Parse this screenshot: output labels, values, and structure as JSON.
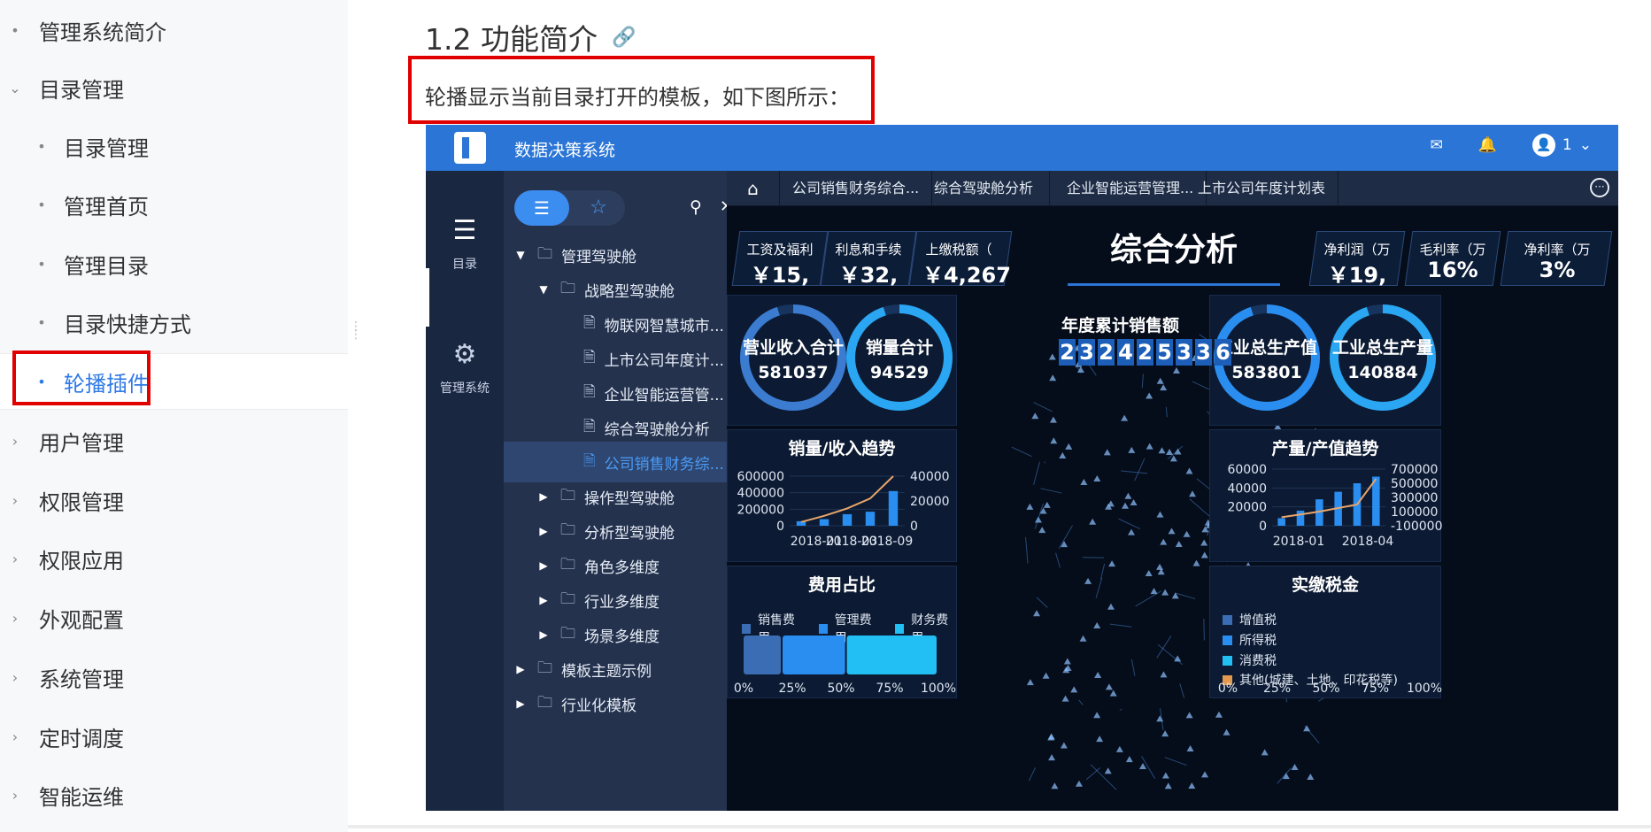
{
  "sidebar": {
    "items": [
      {
        "label": "管理系统简介",
        "mark": "•"
      },
      {
        "label": "目录管理",
        "mark": "⌄"
      },
      {
        "label": "目录管理",
        "mark": "•"
      },
      {
        "label": "管理首页",
        "mark": "•"
      },
      {
        "label": "管理目录",
        "mark": "•"
      },
      {
        "label": "目录快捷方式",
        "mark": "•"
      },
      {
        "label": "轮播插件",
        "mark": "•"
      },
      {
        "label": "用户管理",
        "mark": "›"
      },
      {
        "label": "权限管理",
        "mark": "›"
      },
      {
        "label": "权限应用",
        "mark": "›"
      },
      {
        "label": "外观配置",
        "mark": "›"
      },
      {
        "label": "系统管理",
        "mark": "›"
      },
      {
        "label": "定时调度",
        "mark": "›"
      },
      {
        "label": "智能运维",
        "mark": "›"
      }
    ]
  },
  "content": {
    "heading": "1.2 功能简介",
    "description": "轮播显示当前目录打开的模板，如下图所示："
  },
  "screenshot": {
    "app_title": "数据决策系统",
    "user_label": "1",
    "rail": {
      "catalog": "目录",
      "manage": "管理系统"
    },
    "tabs": [
      "公司销售财务综合...",
      "综合驾驶舱分析",
      "企业智能运营管理...",
      "上市公司年度计划表"
    ],
    "tree": [
      {
        "label": "管理驾驶舱",
        "arrow": "▼",
        "icon": "folder"
      },
      {
        "label": "战略型驾驶舱",
        "arrow": "▼",
        "icon": "folder"
      },
      {
        "label": "物联网智慧城市...",
        "arrow": "",
        "icon": "file"
      },
      {
        "label": "上市公司年度计...",
        "arrow": "",
        "icon": "file"
      },
      {
        "label": "企业智能运营管...",
        "arrow": "",
        "icon": "file"
      },
      {
        "label": "综合驾驶舱分析",
        "arrow": "",
        "icon": "file"
      },
      {
        "label": "公司销售财务综...",
        "arrow": "",
        "icon": "file"
      },
      {
        "label": "操作型驾驶舱",
        "arrow": "▶",
        "icon": "folder"
      },
      {
        "label": "分析型驾驶舱",
        "arrow": "▶",
        "icon": "folder"
      },
      {
        "label": "角色多维度",
        "arrow": "▶",
        "icon": "folder"
      },
      {
        "label": "行业多维度",
        "arrow": "▶",
        "icon": "folder"
      },
      {
        "label": "场景多维度",
        "arrow": "▶",
        "icon": "folder"
      },
      {
        "label": "模板主题示例",
        "arrow": "▶",
        "icon": "folder"
      },
      {
        "label": "行业化模板",
        "arrow": "▶",
        "icon": "folder"
      }
    ],
    "dashboard": {
      "title": "综合分析",
      "kpis_left": [
        {
          "label": "工资及福利",
          "value": "￥15,"
        },
        {
          "label": "利息和手续",
          "value": "￥32,"
        },
        {
          "label": "上缴税额（",
          "value": "￥4,267"
        }
      ],
      "kpis_right": [
        {
          "label": "净利润（万",
          "value": "￥19,"
        },
        {
          "label": "毛利率（万",
          "value": "16%"
        },
        {
          "label": "净利率（万",
          "value": "3%"
        }
      ],
      "gauges_left": [
        {
          "label": "营业收入合计",
          "value": "581037",
          "fill": 0.95
        },
        {
          "label": "销量合计",
          "value": "94529",
          "fill": 0.95
        }
      ],
      "gauges_right": [
        {
          "label": "工业总生产值",
          "value": "583801",
          "fill": 0.95
        },
        {
          "label": "工业总生产量",
          "value": "140884",
          "fill": 0.95
        }
      ],
      "annual_sales_title": "年度累计销售额",
      "annual_sales_digits": [
        "2",
        "3",
        "2",
        "4",
        "2",
        "5",
        "3",
        "3",
        "6"
      ],
      "cost_share_title": "费用占比",
      "tax_title": "实缴税金",
      "tax_legend": [
        "增值税",
        "所得税",
        "消费税",
        "其他(城建、土地、印花税等)"
      ]
    }
  },
  "chart_data": [
    {
      "type": "bar",
      "title": "销量/收入趋势",
      "x_tick_labels": [
        "2018-01",
        "2018-03",
        "2018-09"
      ],
      "y_tick_labels": [
        "600000",
        "400000",
        "200000",
        "0"
      ],
      "y2_tick_labels": [
        "40000",
        "20000",
        "0"
      ],
      "ylim": [
        0,
        600000
      ],
      "y2lim": [
        0,
        40000
      ],
      "series": [
        {
          "type": "bar",
          "values": [
            55000,
            80000,
            140000,
            170000,
            420000
          ]
        },
        {
          "type": "line",
          "axis": "y2",
          "values": [
            3000,
            8000,
            14000,
            22000,
            40000
          ]
        }
      ]
    },
    {
      "type": "bar",
      "title": "产量/产值趋势",
      "x_tick_labels": [
        "2018-01",
        "2018-04"
      ],
      "y_tick_labels": [
        "60000",
        "40000",
        "20000",
        "0"
      ],
      "y2_tick_labels": [
        "700000",
        "500000",
        "300000",
        "100000",
        "-100000"
      ],
      "ylim": [
        0,
        60000
      ],
      "y2lim": [
        -100000,
        700000
      ],
      "series": [
        {
          "type": "bar",
          "values": [
            8000,
            16000,
            28000,
            36000,
            45000,
            52000
          ]
        },
        {
          "type": "line",
          "axis": "y2",
          "values": [
            20000,
            60000,
            100000,
            150000,
            200000,
            560000
          ]
        }
      ]
    },
    {
      "type": "bar",
      "orientation": "horizontal-stacked",
      "title": "费用占比",
      "x_tick_labels": [
        "0%",
        "25%",
        "50%",
        "75%",
        "100%"
      ],
      "series": [
        {
          "name": "销售费用",
          "value": 0.2,
          "color": "#3a6db3"
        },
        {
          "name": "管理费用",
          "value": 0.33,
          "color": "#2a8df0"
        },
        {
          "name": "财务费用",
          "value": 0.47,
          "color": "#22bff5"
        }
      ]
    },
    {
      "type": "bar",
      "title": "实缴税金",
      "x_tick_labels": [
        "0%",
        "25%",
        "50%",
        "75%",
        "100%"
      ],
      "series": [
        {
          "name": "增值税",
          "color": "#3a6db3"
        },
        {
          "name": "所得税",
          "color": "#2a8df0"
        },
        {
          "name": "消费税",
          "color": "#22bff5"
        },
        {
          "name": "其他(城建、土地、印花税等)",
          "color": "#e49a4e"
        }
      ]
    }
  ],
  "colors": {
    "accent": "#2f7ae5",
    "highlight_box": "#e00000",
    "app_blue": "#2a75d6"
  }
}
